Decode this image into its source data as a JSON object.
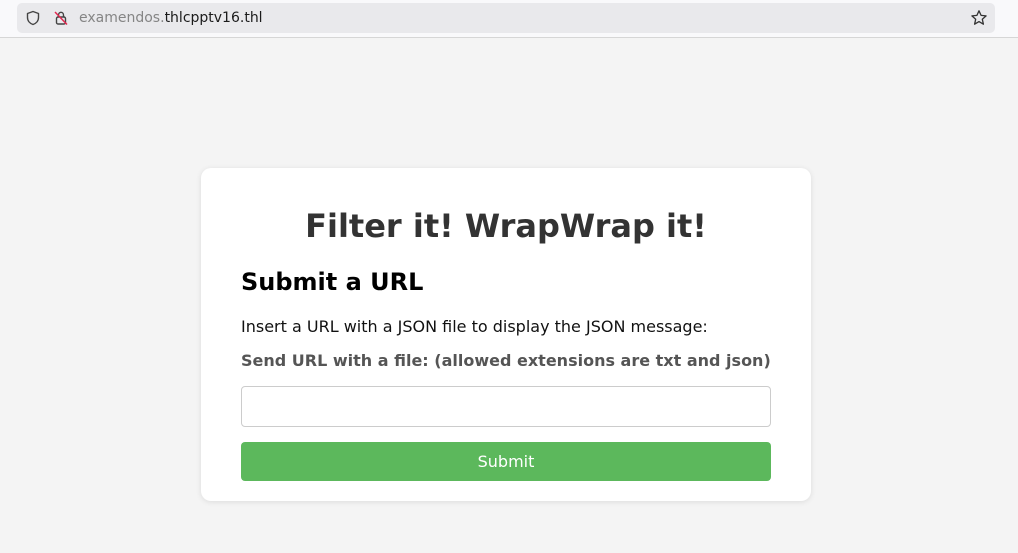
{
  "browser": {
    "url_subdomain": "examendos.",
    "url_domain": "thlcpptv16.thl",
    "icons": [
      "shield-icon",
      "lock-slash-icon",
      "star-icon"
    ]
  },
  "form": {
    "title": "Filter it! WrapWrap it!",
    "heading": "Submit a URL",
    "description": "Insert a URL with a JSON file to display the JSON message:",
    "label": "Send URL with a file: (allowed extensions are txt and json)",
    "input_value": "",
    "input_placeholder": "",
    "submit_label": "Submit"
  },
  "colors": {
    "submit_button": "#5cb85c",
    "page_background": "#f4f4f4",
    "title_text": "#333333",
    "label_text": "#555555"
  }
}
